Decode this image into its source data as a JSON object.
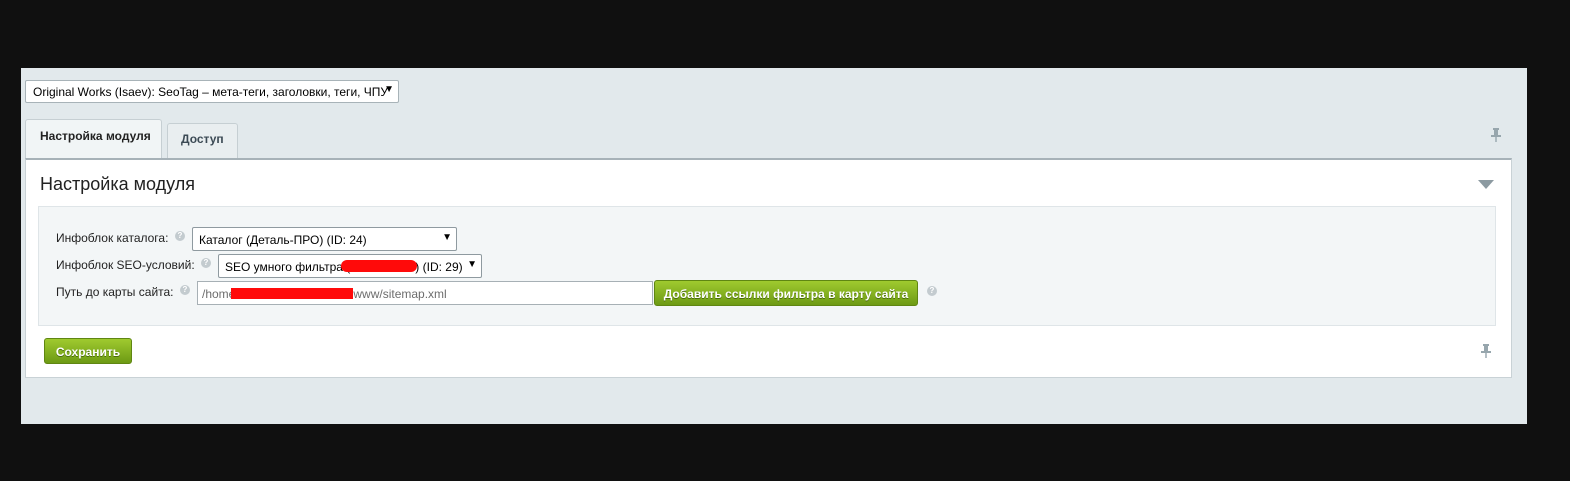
{
  "module_select": {
    "value": "Original Works (Isaev): SeoTag – мета-теги, заголовки, теги, ЧПУ"
  },
  "tabs": [
    {
      "label": "Настройка модуля"
    },
    {
      "label": "Доступ"
    }
  ],
  "section": {
    "title": "Настройка модуля"
  },
  "form": {
    "catalog_iblock": {
      "label": "Инфоблок каталога:",
      "value": "Каталог (Деталь-ПРО) (ID: 24)"
    },
    "seo_iblock": {
      "label": "Инфоблок SEO-условий:",
      "value_prefix": "SEO умного фильтра (",
      "value_suffix": ") (ID: 29)"
    },
    "sitemap": {
      "label": "Путь до карты сайта:",
      "value_prefix": "/home",
      "value_suffix": "www/sitemap.xml"
    },
    "add_links_button": "Добавить ссылки фильтра в карту сайта"
  },
  "save_button": "Сохранить",
  "icons": {
    "help": "?",
    "dropdown": "▼",
    "pin": "pin-icon",
    "collapse": "triangle-down-icon"
  },
  "colors": {
    "accent_green": "#7fab1f",
    "redaction": "#ff0a0a"
  }
}
